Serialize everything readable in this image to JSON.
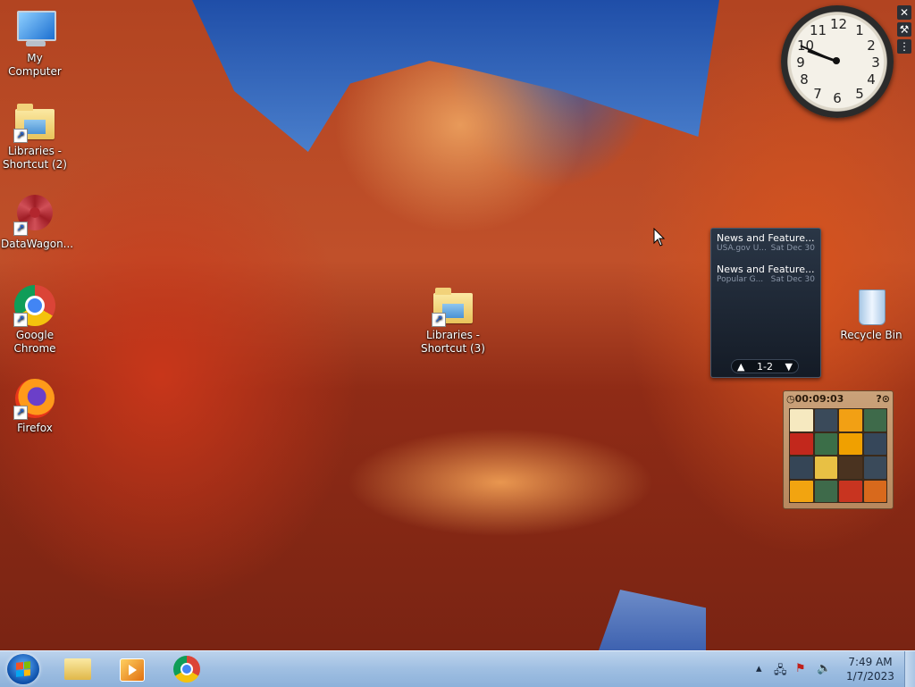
{
  "desktop": {
    "icons": [
      {
        "label": "My Computer",
        "icon": "computer-icon"
      },
      {
        "label": "Libraries - Shortcut (2)",
        "icon": "folder-icon"
      },
      {
        "label": "DataWagon...",
        "icon": "datawagon-icon"
      },
      {
        "label": "Google Chrome",
        "icon": "chrome-icon"
      },
      {
        "label": "Firefox",
        "icon": "firefox-icon"
      },
      {
        "label": "Libraries - Shortcut (3)",
        "icon": "folder-icon"
      },
      {
        "label": "Recycle Bin",
        "icon": "recycle-bin-icon"
      }
    ]
  },
  "clock_gadget": {
    "numbers": [
      "12",
      "1",
      "2",
      "3",
      "4",
      "5",
      "6",
      "7",
      "8",
      "9",
      "10",
      "11"
    ],
    "time": "7:49"
  },
  "feed_gadget": {
    "items": [
      {
        "title": "News and Feature...",
        "source": "USA.gov U...",
        "date": "Sat Dec 30"
      },
      {
        "title": "News and Feature...",
        "source": "Popular G...",
        "date": "Sat Dec 30"
      }
    ],
    "page": "1-2"
  },
  "puzzle_gadget": {
    "timer": "00:09:03"
  },
  "taskbar": {
    "time": "7:49 AM",
    "date": "1/7/2023",
    "pinned": [
      "explorer-icon",
      "media-player-icon",
      "chrome-icon"
    ]
  },
  "colors": {
    "taskbar": "#9fbfe2",
    "feed_bg": "#1c2532",
    "puzzle_bg": "#c0946a"
  }
}
